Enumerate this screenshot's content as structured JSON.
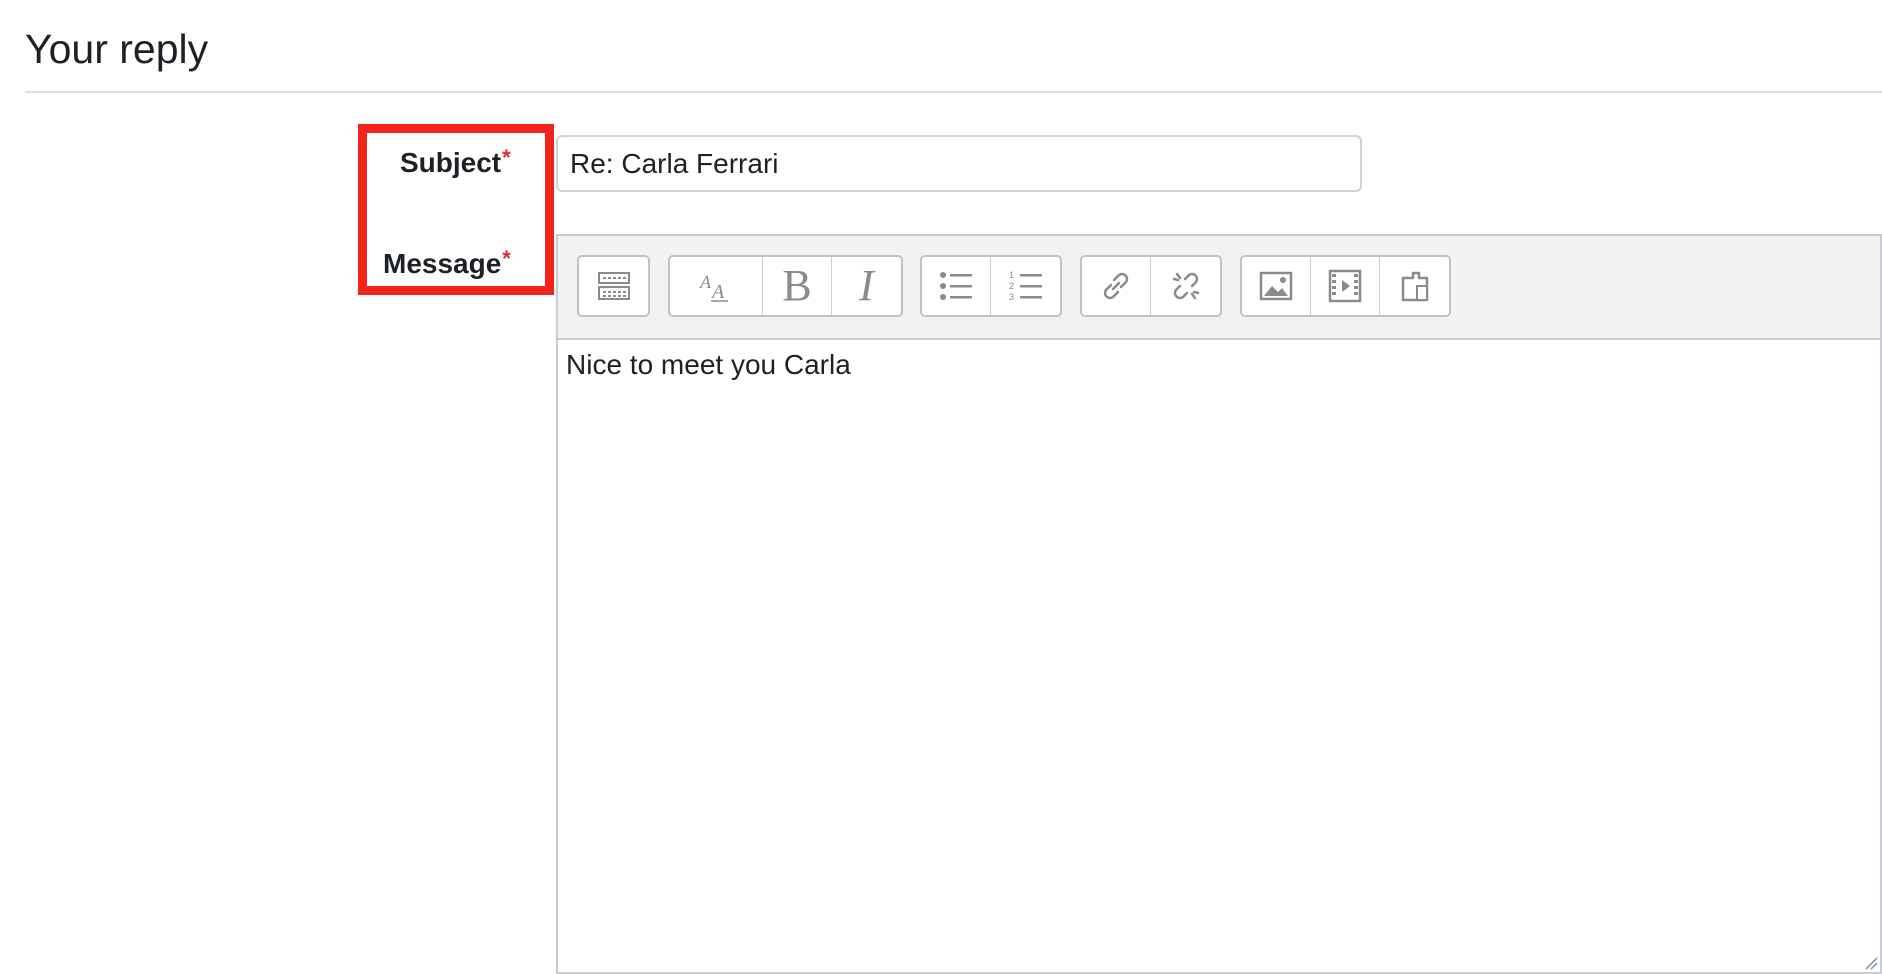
{
  "section": {
    "title": "Your reply"
  },
  "form": {
    "subject": {
      "label": "Subject",
      "required_mark": "*",
      "value": "Re: Carla Ferrari"
    },
    "message": {
      "label": "Message",
      "required_mark": "*",
      "content": "Nice to meet you Carla"
    }
  },
  "toolbar": {
    "groups": [
      [
        "toolbar-toggle-icon"
      ],
      [
        "font-size-icon",
        "bold-icon",
        "italic-icon"
      ],
      [
        "unordered-list-icon",
        "ordered-list-icon"
      ],
      [
        "link-icon",
        "unlink-icon"
      ],
      [
        "image-icon",
        "media-icon",
        "file-icon"
      ]
    ],
    "bold_glyph": "B",
    "italic_glyph": "I"
  },
  "colors": {
    "highlight": "#f2231a",
    "required": "#e5282b",
    "toolbar_bg": "#f2f2f2"
  }
}
